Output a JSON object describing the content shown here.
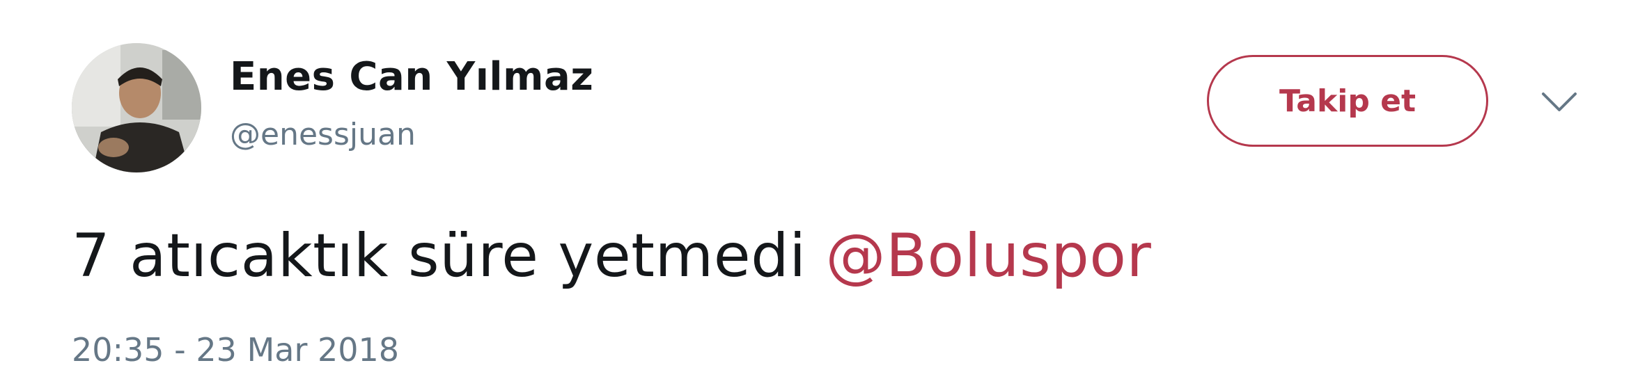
{
  "author": {
    "display_name": "Enes Can Yılmaz",
    "username": "@enessjuan"
  },
  "actions": {
    "follow_label": "Takip et",
    "menu_icon": "chevron-down-icon"
  },
  "tweet": {
    "text": "7 atıcaktık süre yetmedi",
    "mention": "@Boluspor",
    "timestamp": "20:35 - 23 Mar 2018"
  },
  "colors": {
    "accent": "#b5384d",
    "text": "#14171a",
    "secondary": "#657786"
  }
}
